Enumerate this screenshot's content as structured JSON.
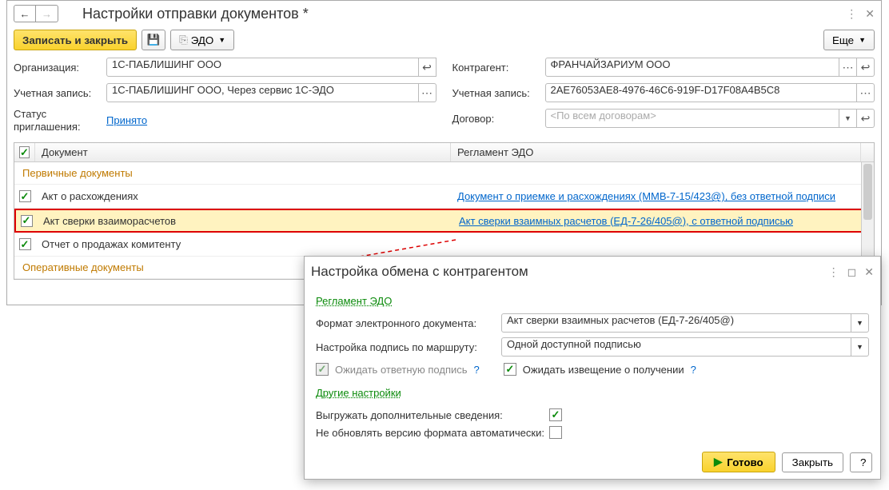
{
  "main": {
    "title": "Настройки отправки документов *",
    "toolbar": {
      "save_close": "Записать и закрыть",
      "edo": "ЭДО",
      "more": "Еще"
    },
    "left": {
      "org_label": "Организация:",
      "org_value": "1С-ПАБЛИШИНГ ООО",
      "acct_label": "Учетная запись:",
      "acct_value": "1С-ПАБЛИШИНГ ООО, Через сервис 1С-ЭДО",
      "status_label": "Статус приглашения:",
      "status_value": "Принято"
    },
    "right": {
      "contr_label": "Контрагент:",
      "contr_value": "ФРАНЧАЙЗАРИУМ ООО",
      "acct_label": "Учетная запись:",
      "acct_value": "2AE76053AE8-4976-46C6-919F-D17F08A4B5C8",
      "dog_label": "Договор:",
      "dog_placeholder": "<По всем договорам>"
    },
    "grid": {
      "col_doc": "Документ",
      "col_reg": "Регламент ЭДО",
      "group1": "Первичные документы",
      "rows": [
        {
          "doc": "Акт о расхождениях",
          "reg": "Документ о приемке и расхождениях (ММВ-7-15/423@), без ответной подписи"
        },
        {
          "doc": "Акт сверки взаиморасчетов",
          "reg": "Акт сверки взаимных расчетов (ЕД-7-26/405@), с ответной подписью"
        },
        {
          "doc": "Отчет о продажах комитенту",
          "reg": ""
        }
      ],
      "group2": "Оперативные документы"
    }
  },
  "popup": {
    "title": "Настройка обмена с контрагентом",
    "reg_section": "Регламент ЭДО",
    "format_label": "Формат электронного документа:",
    "format_value": "Акт сверки взаимных расчетов (ЕД-7-26/405@)",
    "sign_label": "Настройка подпись по маршруту:",
    "sign_value": "Одной доступной подписью",
    "wait_reply": "Ожидать ответную подпись",
    "wait_notice": "Ожидать извещение о получении",
    "other_section": "Другие настройки",
    "opt_extra": "Выгружать дополнительные сведения:",
    "opt_noupd": "Не обновлять версию формата автоматически:",
    "ready": "Готово",
    "close": "Закрыть"
  }
}
